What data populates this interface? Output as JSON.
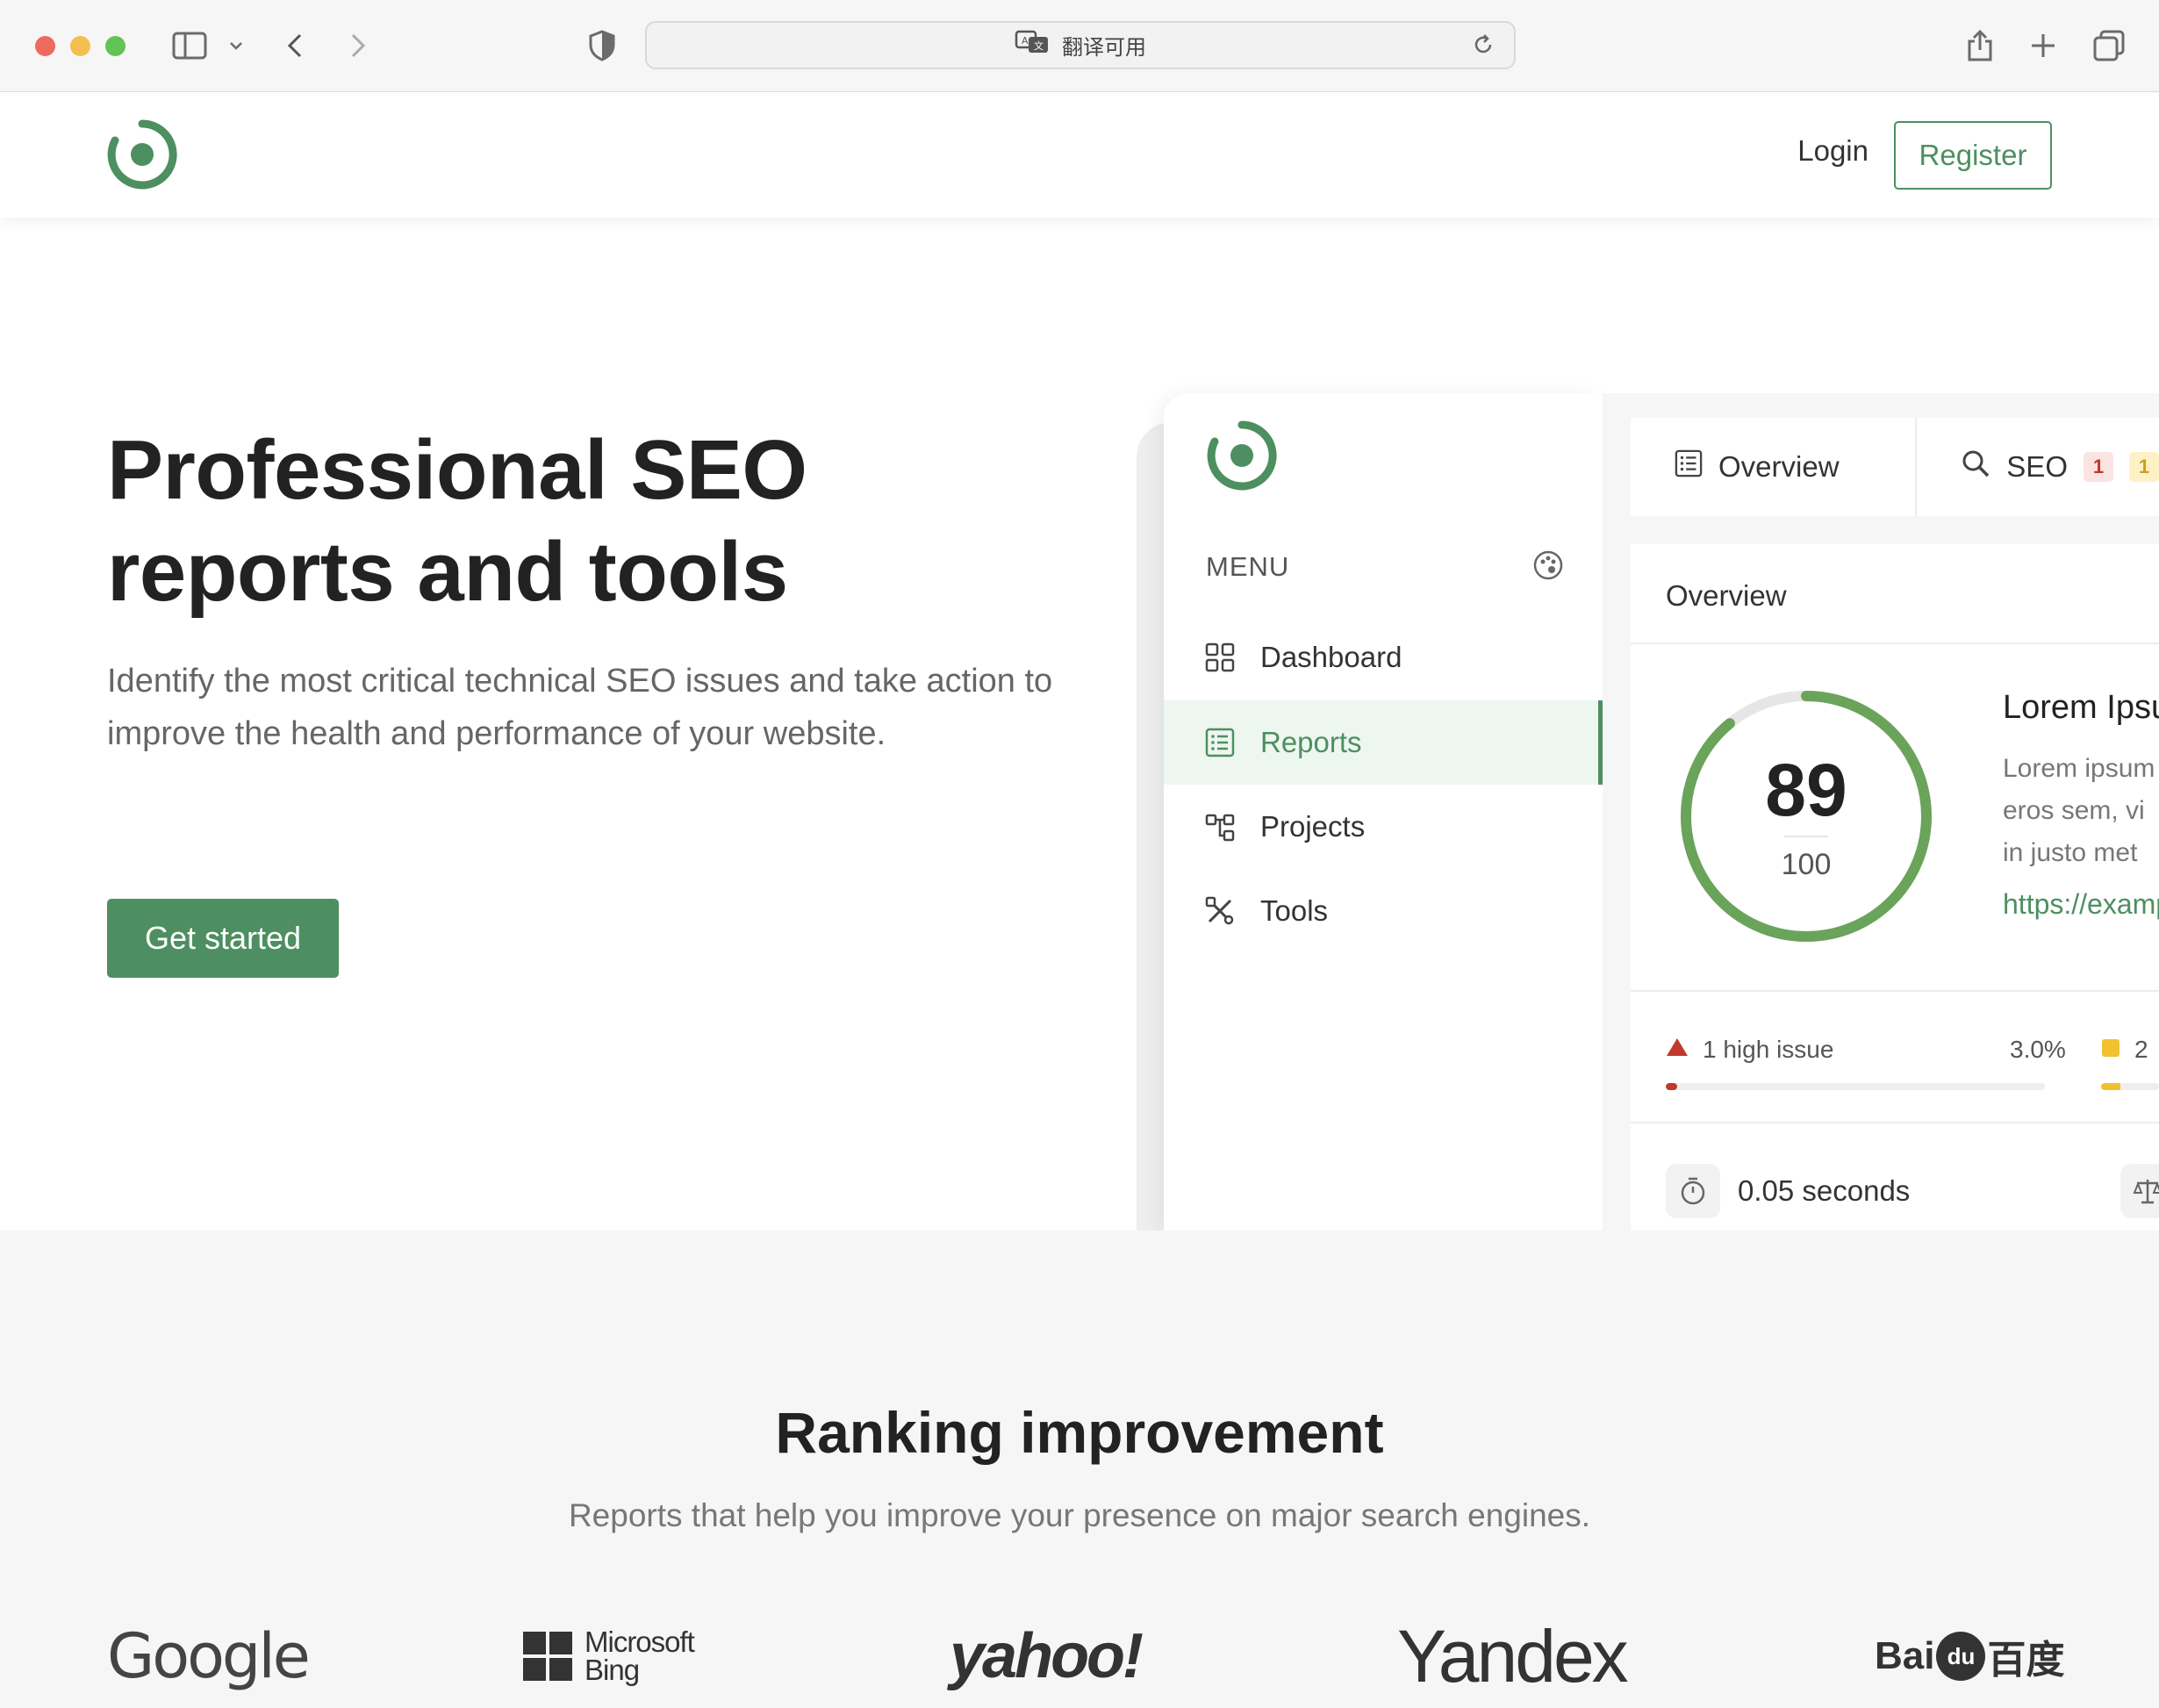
{
  "browser": {
    "address_text": "翻译可用"
  },
  "header": {
    "login_label": "Login",
    "register_label": "Register"
  },
  "hero": {
    "title": "Professional SEO reports and tools",
    "lead": "Identify the most critical technical SEO issues and take action to improve the health and performance of your website.",
    "cta_label": "Get started"
  },
  "dashboard": {
    "menu_label": "MENU",
    "nav": [
      {
        "label": "Dashboard",
        "icon": "grid-icon"
      },
      {
        "label": "Reports",
        "icon": "report-icon",
        "active": true
      },
      {
        "label": "Projects",
        "icon": "sitemap-icon"
      },
      {
        "label": "Tools",
        "icon": "tools-icon"
      }
    ],
    "tabs": [
      {
        "label": "Overview",
        "icon": "report-icon"
      },
      {
        "label": "SEO",
        "icon": "search-icon",
        "badge_red": "1",
        "badge_yellow": "1"
      }
    ],
    "card_title": "Overview",
    "score": 89,
    "score_max": "100",
    "lorem_title": "Lorem Ipsum",
    "lorem_lines": [
      "Lorem ipsum",
      "eros sem, vi",
      "in justo met"
    ],
    "lorem_url": "https://example",
    "high_issue_label": "1 high issue",
    "high_issue_pct": "3.0%",
    "high_issue_fraction": 0.03,
    "medium_issue_label": "2",
    "load_time": "0.05 seconds",
    "colors": {
      "accent": "#4d8f60",
      "score_ring": "#6aa35a",
      "high": "#c0392b",
      "medium": "#f2c12e"
    }
  },
  "ranking": {
    "title": "Ranking improvement",
    "subtitle": "Reports that help you improve your presence on major search engines.",
    "engines": {
      "google": "Google",
      "bing_line1": "Microsoft",
      "bing_line2": "Bing",
      "yahoo": "yahoo!",
      "yandex": "Yandex",
      "baidu_left": "Bai",
      "baidu_paw": "du",
      "baidu_right": "百度"
    }
  }
}
